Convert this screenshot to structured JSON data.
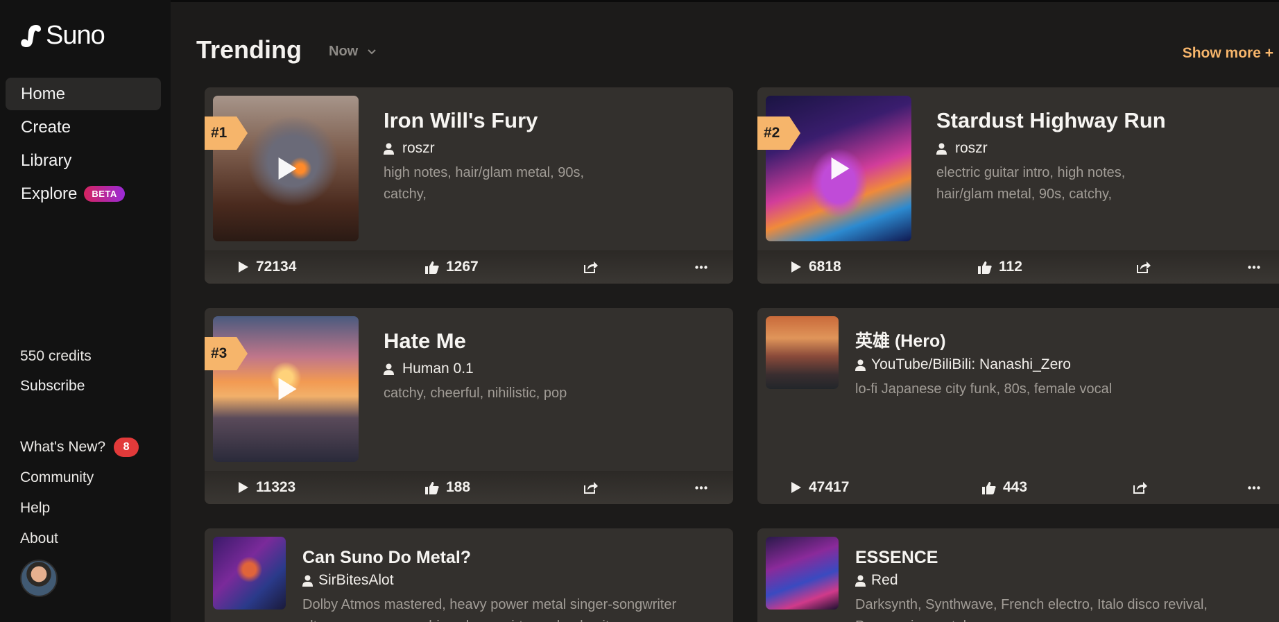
{
  "app": {
    "name": "Suno"
  },
  "sidebar": {
    "nav": [
      {
        "label": "Home",
        "active": true
      },
      {
        "label": "Create"
      },
      {
        "label": "Library"
      },
      {
        "label": "Explore",
        "badge": "BETA"
      }
    ],
    "credits": "550 credits",
    "subscribe": "Subscribe",
    "links": [
      {
        "label": "What's New?",
        "badge": "8"
      },
      {
        "label": "Community"
      },
      {
        "label": "Help"
      },
      {
        "label": "About"
      }
    ]
  },
  "trending": {
    "heading": "Trending",
    "period": "Now",
    "show_more": "Show more +",
    "songs": [
      {
        "rank": "#1",
        "title": "Iron Will's Fury",
        "author": "roszr",
        "tags": "high notes, hair/glam metal, 90s, catchy,",
        "plays": "72134",
        "likes": "1267"
      },
      {
        "rank": "#2",
        "title": "Stardust Highway Run",
        "author": "roszr",
        "tags": "electric guitar intro, high notes, hair/glam metal, 90s, catchy,",
        "plays": "6818",
        "likes": "112"
      },
      {
        "rank": "#3",
        "title": "Hate Me",
        "author": "Human 0.1",
        "tags": "catchy, cheerful, nihilistic, pop",
        "plays": "11323",
        "likes": "188"
      },
      {
        "title": "英雄 (Hero)",
        "author": "YouTube/BiliBili: Nanashi_Zero",
        "tags": "lo-fi Japanese city funk, 80s, female vocal",
        "plays": "47417",
        "likes": "443"
      },
      {
        "title": "Can Suno Do Metal?",
        "author": "SirBitesAlot",
        "tags": "Dolby Atmos mastered, heavy power metal singer-songwriter ultra raw asmr, overdriven hyper virtuoso lead guitar"
      },
      {
        "title": "ESSENCE",
        "author": "Red",
        "tags": "Darksynth, Synthwave, French electro, Italo disco revival, Progressive metal"
      }
    ]
  },
  "colors": {
    "accent": "#f6b56b",
    "card": "#33302d",
    "badge_red": "#e23a3a"
  }
}
